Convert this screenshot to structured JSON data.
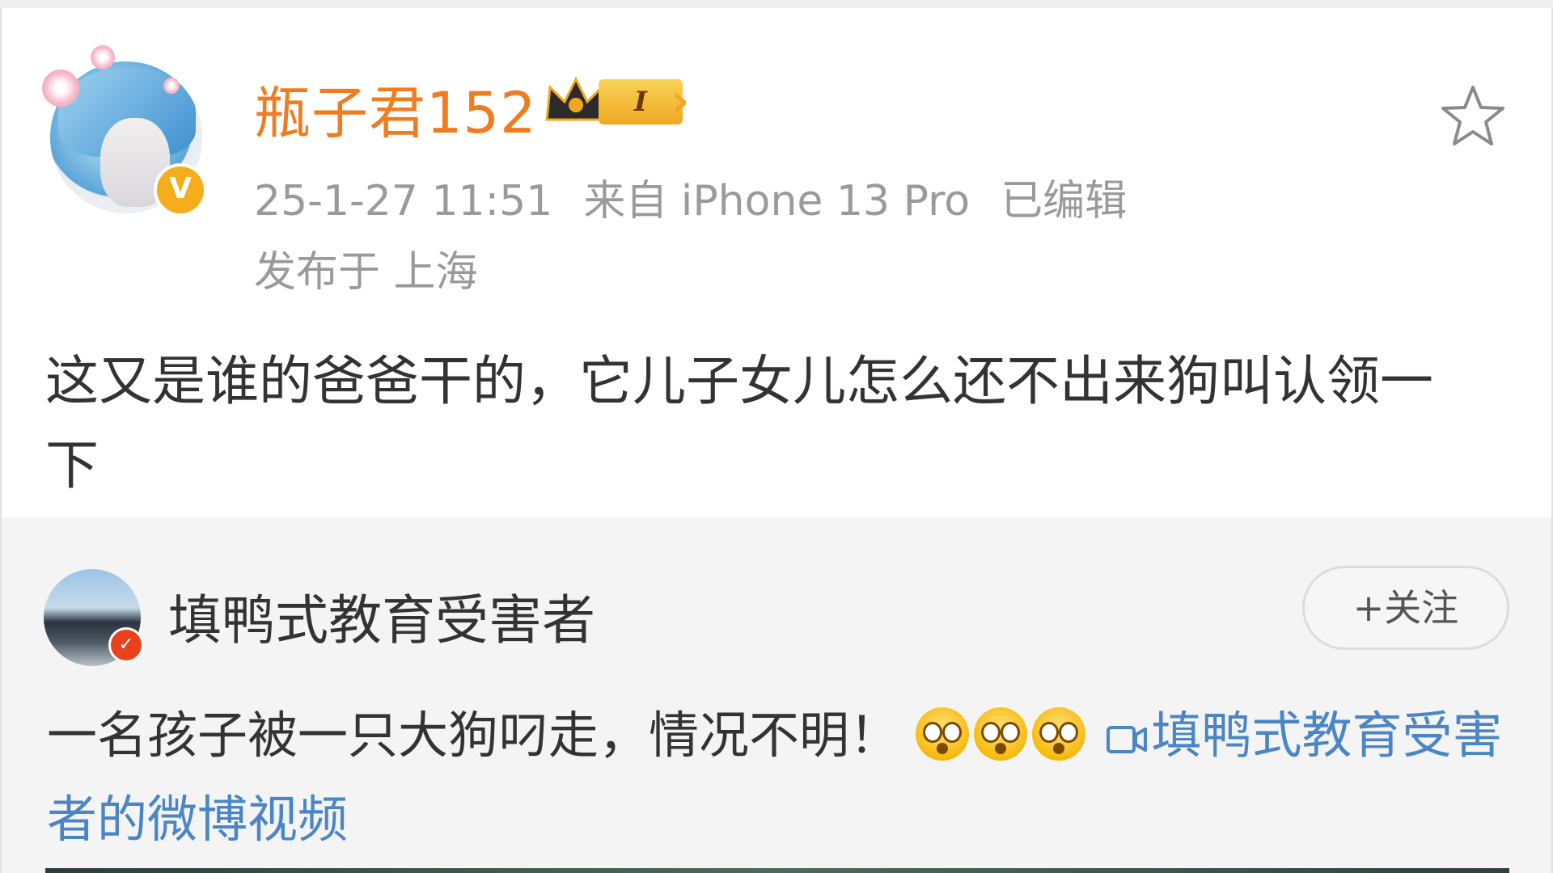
{
  "post": {
    "username": "瓶子君152",
    "vip_level": "I",
    "verified_mark": "V",
    "timestamp": "25-1-27 11:51",
    "source": "来自 iPhone 13 Pro",
    "edited": "已编辑",
    "location": "发布于 上海",
    "text": "这又是谁的爸爸干的，它儿子女儿怎么还不出来狗叫认领一下",
    "icons": [
      "avatar",
      "verified-badge-icon",
      "crown-icon",
      "star-icon"
    ],
    "colors": {
      "username": "#f07c20",
      "meta": "#9a9a9a",
      "verified": "#f6ad1c"
    }
  },
  "repost": {
    "author": "填鸭式教育受害者",
    "follow_label": "+关注",
    "text": "一名孩子被一只大狗叼走，情况不明！",
    "emoji_count": 3,
    "video_link": "填鸭式教育受害者的微博视频",
    "icons": [
      "avatar",
      "verified-badge-icon",
      "shocked-emoji-icon",
      "video-camera-icon"
    ],
    "colors": {
      "background": "#f4f4f4",
      "link": "#4a86c6",
      "badge": "#e8411c"
    }
  }
}
